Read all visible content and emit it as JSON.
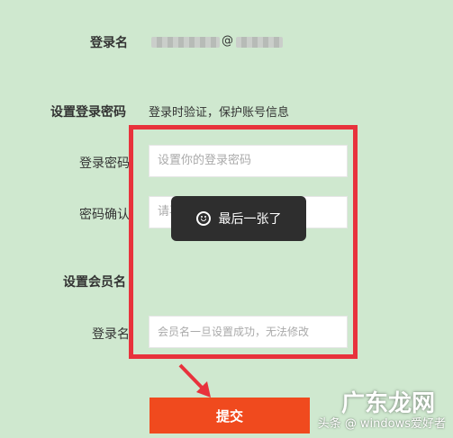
{
  "form": {
    "login_name_label": "登录名",
    "login_name_at": "@",
    "password_section_label": "设置登录密码",
    "password_section_hint": "登录时验证，保护账号信息",
    "password_label": "登录密码",
    "password_placeholder": "设置你的登录密码",
    "confirm_label": "密码确认",
    "confirm_placeholder": "请再次输入你的密码",
    "member_section_label": "设置会员名",
    "member_label": "登录名",
    "member_placeholder": "会员名一旦设置成功，无法修改",
    "submit_label": "提交"
  },
  "toast": {
    "text": "最后一张了"
  },
  "watermark": {
    "prefix": "头条 @",
    "account": "windows爱好者",
    "brand": "广东龙网"
  },
  "colors": {
    "background": "#cfe8cf",
    "highlight_border": "#e8323c",
    "submit": "#f04a1e",
    "toast": "#2e2e2e"
  }
}
